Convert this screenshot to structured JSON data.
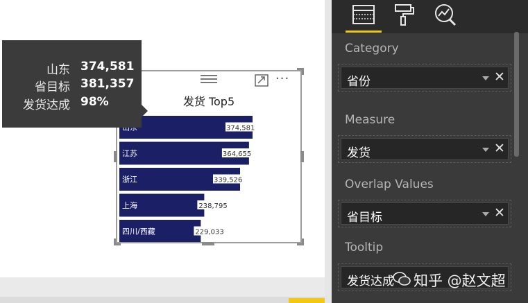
{
  "visual": {
    "title": "发货 Top5",
    "more_label": "···"
  },
  "tooltip": {
    "rows": [
      {
        "label": "山东",
        "value": "374,581"
      },
      {
        "label": "省目标",
        "value": "381,357"
      },
      {
        "label": "发货达成",
        "value": "98%"
      }
    ]
  },
  "chart_data": {
    "type": "bar",
    "orientation": "horizontal",
    "title": "发货 Top5",
    "categories": [
      "山东",
      "江苏",
      "浙江",
      "上海",
      "四川/西藏"
    ],
    "series": [
      {
        "values": [
          374581,
          364655,
          339526,
          238795,
          229033
        ]
      }
    ],
    "data_labels": [
      "374,581",
      "364,655",
      "339,526",
      "238,795",
      "229,033"
    ],
    "bar_color": "#1b1f66",
    "xlim": [
      0,
      400000
    ],
    "grid": false
  },
  "pane": {
    "sections": [
      {
        "label": "Category",
        "field": "省份"
      },
      {
        "label": "Measure",
        "field": "发货"
      },
      {
        "label": "Overlap Values",
        "field": "省目标"
      },
      {
        "label": "Tooltip",
        "field": "发货达成"
      }
    ],
    "accent": "#f2c811",
    "tabs": [
      "fields-icon",
      "format-paint-icon",
      "analytics-icon"
    ]
  },
  "watermark": "知乎 @赵文超"
}
